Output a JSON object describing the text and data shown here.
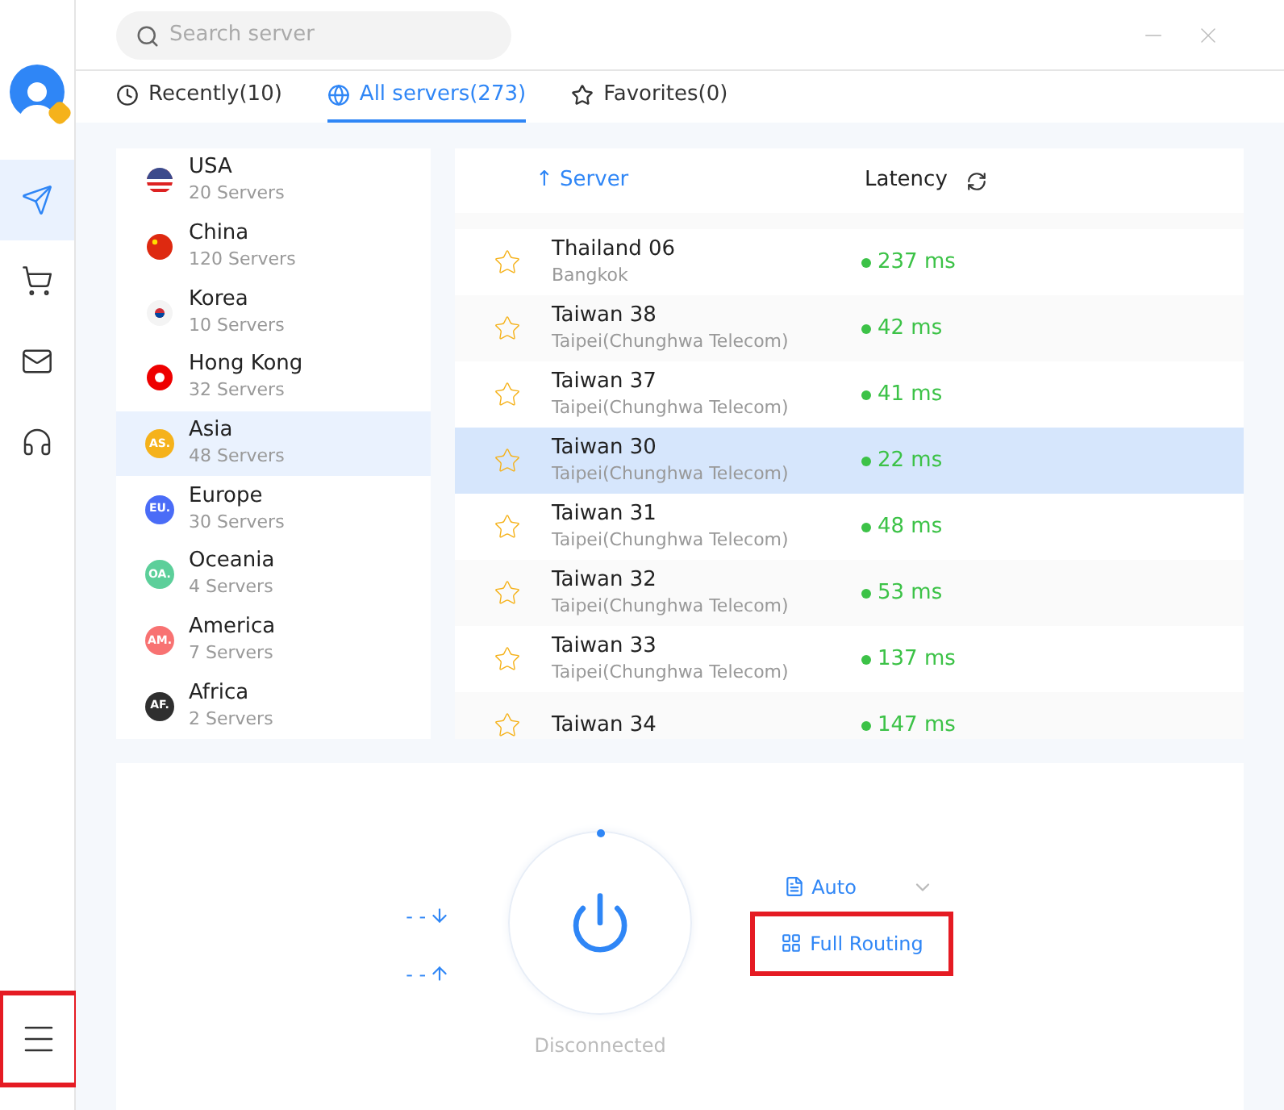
{
  "search": {
    "placeholder": "Search server"
  },
  "sidebar": {
    "items": [
      {
        "kind": "send",
        "selected": true
      },
      {
        "kind": "cart",
        "selected": false
      },
      {
        "kind": "mail",
        "selected": false
      },
      {
        "kind": "support",
        "selected": false
      }
    ],
    "menu": {
      "highlighted": true
    }
  },
  "tabs": [
    {
      "label": "Recently(10)",
      "kind": "clock",
      "selected": false
    },
    {
      "label": "All servers(273)",
      "kind": "globe",
      "selected": true
    },
    {
      "label": "Favorites(0)",
      "kind": "star",
      "selected": false
    }
  ],
  "regions": [
    {
      "name": "USA",
      "count": "20 Servers",
      "kind": "flag-us",
      "selected": false
    },
    {
      "name": "China",
      "count": "120 Servers",
      "kind": "flag-cn",
      "selected": false
    },
    {
      "name": "Korea",
      "count": "10 Servers",
      "kind": "flag-kr",
      "selected": false
    },
    {
      "name": "Hong Kong",
      "count": "32 Servers",
      "kind": "flag-hk",
      "selected": false
    },
    {
      "name": "Asia",
      "count": "48 Servers",
      "kind": "badge",
      "badge": "AS.",
      "color": "#f5b21b",
      "selected": true
    },
    {
      "name": "Europe",
      "count": "30 Servers",
      "kind": "badge",
      "badge": "EU.",
      "color": "#4a6cf7",
      "selected": false
    },
    {
      "name": "Oceania",
      "count": "4 Servers",
      "kind": "badge",
      "badge": "OA.",
      "color": "#5ccf9a",
      "selected": false
    },
    {
      "name": "America",
      "count": "7 Servers",
      "kind": "badge",
      "badge": "AM.",
      "color": "#f87272",
      "selected": false
    },
    {
      "name": "Africa",
      "count": "2 Servers",
      "kind": "badge",
      "badge": "AF.",
      "color": "#2f2f2f",
      "selected": false
    }
  ],
  "table": {
    "columns": [
      "↑ Server",
      "Latency"
    ],
    "rows": [
      {
        "name": "Thailand 06",
        "location": "Bangkok",
        "latency": "237 ms",
        "selected": false
      },
      {
        "name": "Taiwan 38",
        "location": "Taipei(Chunghwa Telecom)",
        "latency": "42 ms",
        "selected": false
      },
      {
        "name": "Taiwan 37",
        "location": "Taipei(Chunghwa Telecom)",
        "latency": "41 ms",
        "selected": false
      },
      {
        "name": "Taiwan 30",
        "location": "Taipei(Chunghwa Telecom)",
        "latency": "22 ms",
        "selected": true
      },
      {
        "name": "Taiwan 31",
        "location": "Taipei(Chunghwa Telecom)",
        "latency": "48 ms",
        "selected": false
      },
      {
        "name": "Taiwan 32",
        "location": "Taipei(Chunghwa Telecom)",
        "latency": "53 ms",
        "selected": false
      },
      {
        "name": "Taiwan 33",
        "location": "Taipei(Chunghwa Telecom)",
        "latency": "137 ms",
        "selected": false
      },
      {
        "name": "Taiwan 34",
        "latency": "147 ms",
        "selected": false
      }
    ]
  },
  "connection": {
    "download": "- -",
    "upload": "- -",
    "status": "Disconnected",
    "protocol": "Auto",
    "routing": {
      "label": "Full Routing",
      "highlighted": true
    }
  }
}
